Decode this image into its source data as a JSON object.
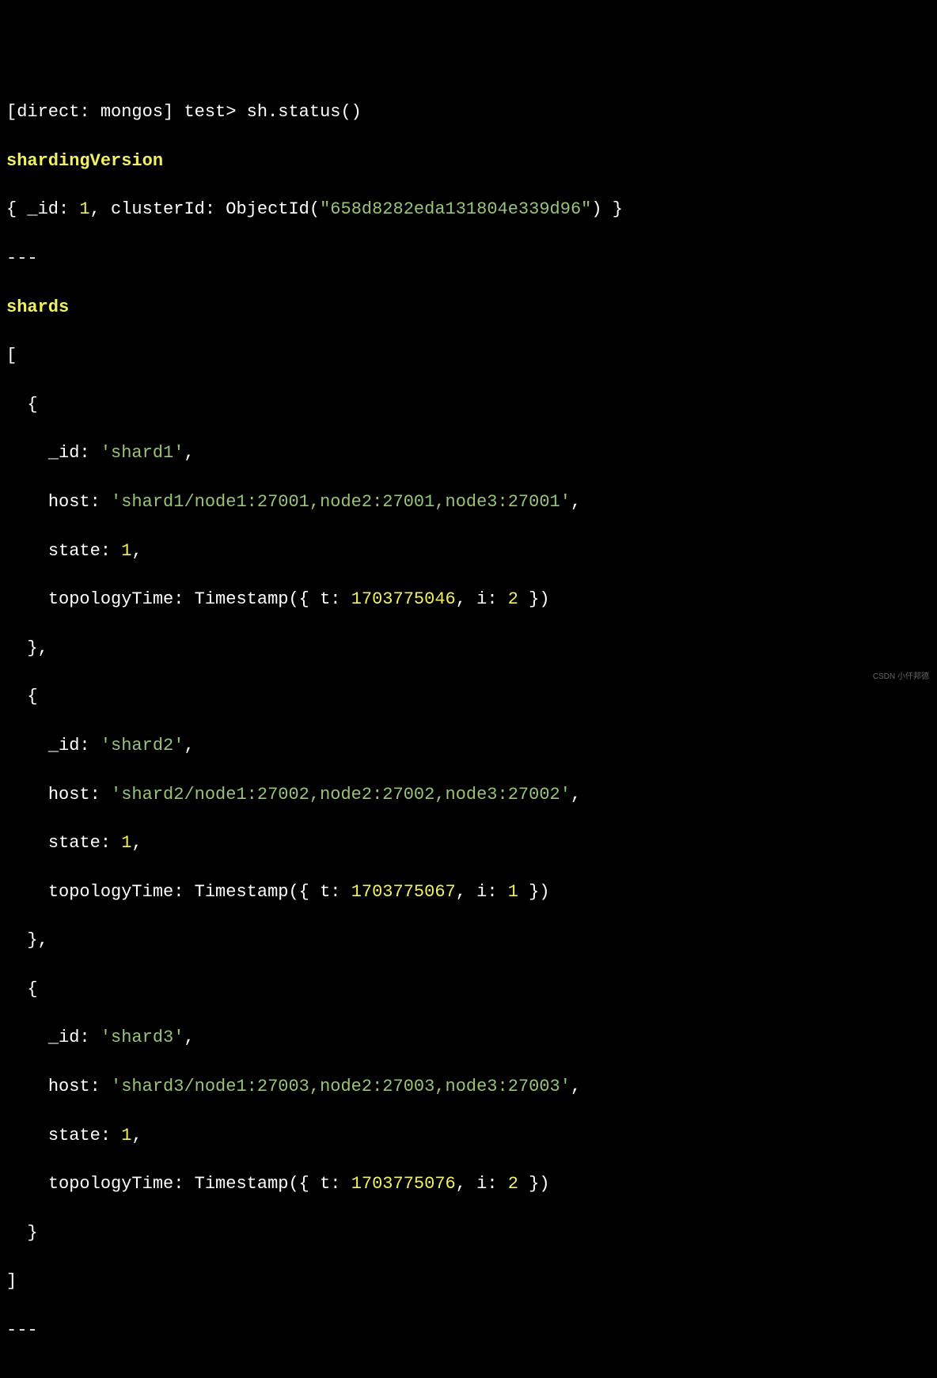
{
  "prompt": {
    "context": "[direct: mongos]",
    "db": "test",
    "marker": ">",
    "command": "sh.status()"
  },
  "shardingVersion": {
    "header": "shardingVersion",
    "idKey": "_id",
    "idVal": "1",
    "clusterIdKey": "clusterId",
    "clusterIdFunc": "ObjectId",
    "clusterIdVal": "\"658d8282eda131804e339d96\""
  },
  "separator": "---",
  "shardsHeader": "shards",
  "shards": [
    {
      "id": "'shard1'",
      "host": "'shard1/node1:27001,node2:27001,node3:27001'",
      "state": "1",
      "topologyT": "1703775046",
      "topologyI": "2"
    },
    {
      "id": "'shard2'",
      "host": "'shard2/node1:27002,node2:27002,node3:27002'",
      "state": "1",
      "topologyT": "1703775067",
      "topologyI": "1"
    },
    {
      "id": "'shard3'",
      "host": "'shard3/node1:27003,node2:27003,node3:27003'",
      "state": "1",
      "topologyT": "1703775076",
      "topologyI": "2"
    }
  ],
  "keys": {
    "id": "_id",
    "host": "host",
    "state": "state",
    "topologyTime": "topologyTime",
    "timestamp": "Timestamp",
    "t": "t",
    "i": "i"
  },
  "watermark": "CSDN 小仟邦德"
}
